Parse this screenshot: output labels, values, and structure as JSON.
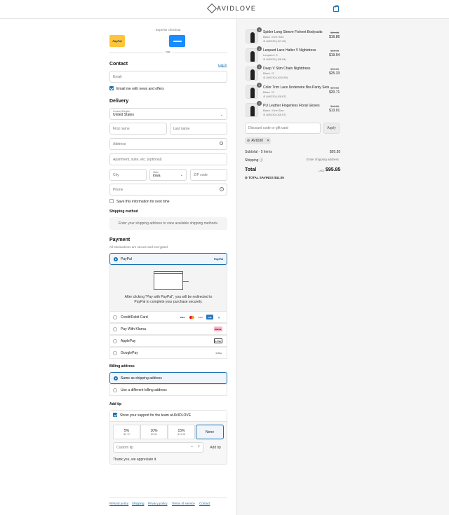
{
  "header": {
    "brand": "AVIDLOVE"
  },
  "express": {
    "label": "Express checkout",
    "paypal": "PayPal",
    "or": "OR"
  },
  "contact": {
    "title": "Contact",
    "login": "Log in",
    "email_placeholder": "Email",
    "newsletter": "Email me with news and offers"
  },
  "delivery": {
    "title": "Delivery",
    "country_label": "Country/Region",
    "country": "United States",
    "first_name": "First name",
    "last_name": "Last name",
    "address": "Address",
    "apartment": "Apartment, suite, etc. (optional)",
    "city": "City",
    "state_label": "State",
    "state": "Iowa",
    "zip": "ZIP code",
    "phone": "Phone",
    "save_info": "Save this information for next time"
  },
  "shipping_method": {
    "title": "Shipping method",
    "note": "Enter your shipping address to view available shipping methods."
  },
  "payment": {
    "title": "Payment",
    "subtitle": "All transactions are secure and encrypted.",
    "paypal_label": "PayPal",
    "paypal_logo": "PayPal",
    "redirect_text_1": "After clicking \"Pay with PayPal\", you will be redirected to",
    "redirect_text_2": "PayPal to complete your purchase securely.",
    "card_label": "Credit/Debit Card",
    "klarna_label": "Pay With Klarna",
    "klarna_logo": "Klarna.",
    "applepay_label": "ApplePay",
    "applepay_logo": "Pay",
    "googlepay_label": "GooglePay",
    "googlepay_logo": "G Pay"
  },
  "billing": {
    "title": "Billing address",
    "same": "Same as shipping address",
    "different": "Use a different billing address"
  },
  "tip": {
    "title": "Add tip",
    "support": "Show your support for the team at AVIDLOVE",
    "options": [
      {
        "pct": "5%",
        "amt": "$4.79"
      },
      {
        "pct": "10%",
        "amt": "$9.59"
      },
      {
        "pct": "15%",
        "amt": "$14.38"
      }
    ],
    "none": "None",
    "custom_placeholder": "Custom tip",
    "add": "Add tip",
    "thanks": "Thank you, we appreciate it."
  },
  "footer": {
    "links": [
      "Refund policy",
      "Shipping",
      "Privacy policy",
      "Terms of service",
      "Contact"
    ]
  },
  "order": {
    "items": [
      {
        "qty": "1",
        "name": "Spider Long Sleeve Fishnet Bodysuits",
        "variant": "Black / One Size",
        "discount": "AVID30 (-$7.22)",
        "old": "$24.08",
        "price": "$16.86"
      },
      {
        "qty": "1",
        "name": "Leopard Lace Halter V Nightdress",
        "variant": "Leopard / S",
        "discount": "AVID30 (-$8.54)",
        "old": "$28.48",
        "price": "$19.94"
      },
      {
        "qty": "1",
        "name": "Deep V Slim Chain Nightdress",
        "variant": "Black / S",
        "discount": "AVID30 (-$10.85)",
        "old": "$36.18",
        "price": "$25.33"
      },
      {
        "qty": "1",
        "name": "Color Trim Lace Underwire Bra Panty Sets",
        "variant": "Black / S",
        "discount": "AVID30 (-$8.87)",
        "old": "$29.58",
        "price": "$20.71"
      },
      {
        "qty": "1",
        "name": "PU Leather Fingerless Floral Gloves",
        "variant": "Black / One Size",
        "discount": "AVID30 (-$5.57)",
        "old": "$18.58",
        "price": "$13.01"
      }
    ],
    "discount_placeholder": "Discount code or gift card",
    "apply": "Apply",
    "applied_code": "AVID30",
    "subtotal_label": "Subtotal · 5 items",
    "subtotal": "$95.85",
    "shipping_label": "Shipping",
    "shipping_value": "Enter shipping address",
    "total_label": "Total",
    "currency": "USD",
    "total": "$95.85",
    "savings": "TOTAL SAVINGS  $41.05"
  }
}
